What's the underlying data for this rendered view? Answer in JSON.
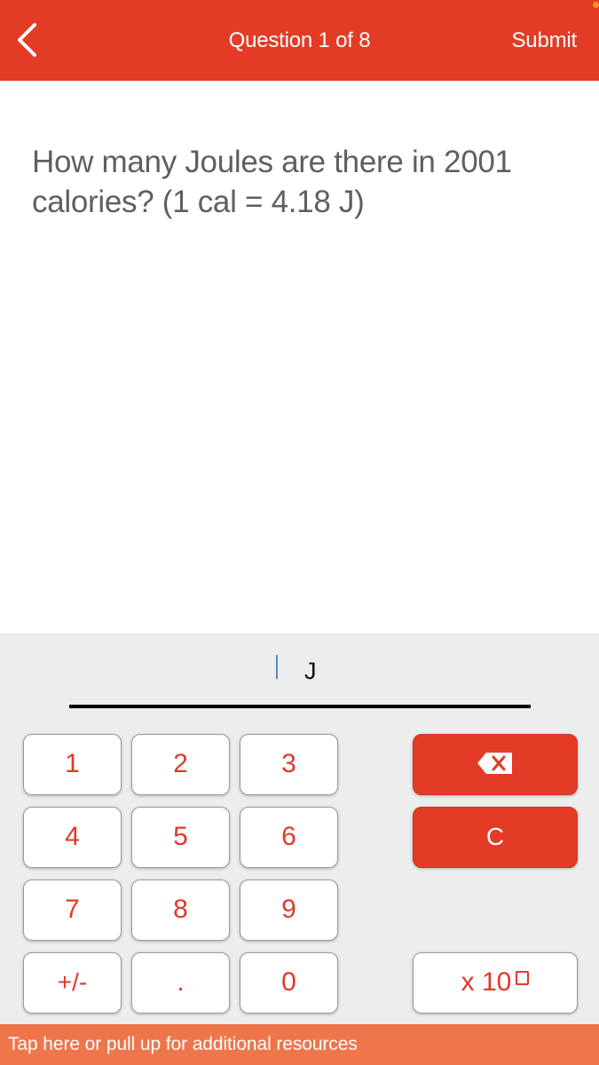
{
  "header": {
    "back_icon": "chevron-left-icon",
    "title": "Question 1 of 8",
    "submit_label": "Submit",
    "background": "#e43b26"
  },
  "question": {
    "text": "How many Joules are there in 2001 calories? (1 cal = 4.18 J)"
  },
  "answer": {
    "value": "",
    "unit": "J"
  },
  "keypad": {
    "digits": [
      {
        "key": "1",
        "label": "1"
      },
      {
        "key": "2",
        "label": "2"
      },
      {
        "key": "3",
        "label": "3"
      },
      {
        "key": "4",
        "label": "4"
      },
      {
        "key": "5",
        "label": "5"
      },
      {
        "key": "6",
        "label": "6"
      },
      {
        "key": "7",
        "label": "7"
      },
      {
        "key": "8",
        "label": "8"
      },
      {
        "key": "9",
        "label": "9"
      },
      {
        "key": "plusminus",
        "label": "+/-"
      },
      {
        "key": "decimal",
        "label": "."
      },
      {
        "key": "0",
        "label": "0"
      }
    ],
    "backspace_icon": "backspace-icon",
    "clear_label": "C",
    "exponent_label": "x 10",
    "accent_color": "#e0392a"
  },
  "footer": {
    "text": "Tap here or pull up for additional resources",
    "background": "#ef754b"
  }
}
